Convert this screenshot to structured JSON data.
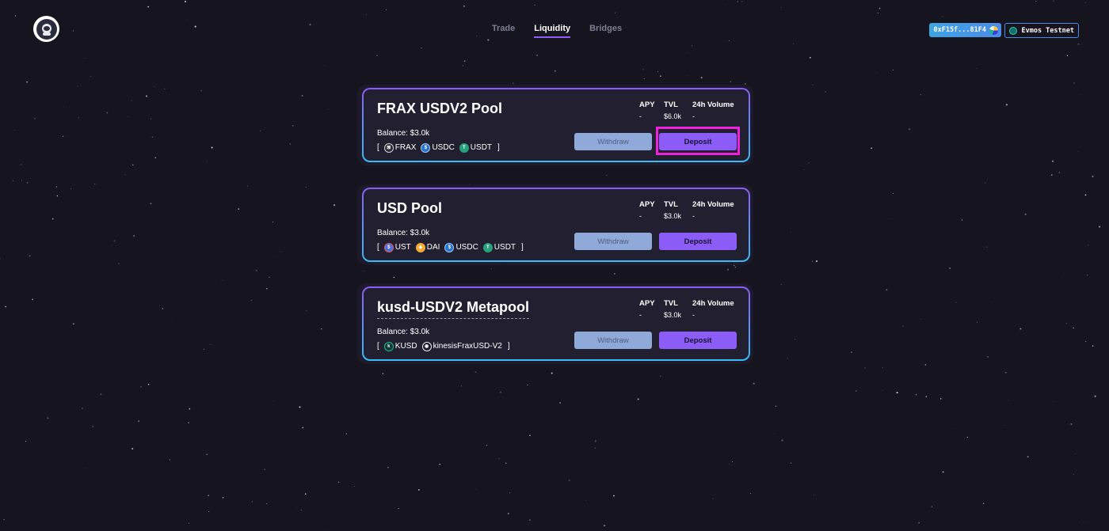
{
  "nav": {
    "items": [
      {
        "label": "Trade",
        "active": false
      },
      {
        "label": "Liquidity",
        "active": true
      },
      {
        "label": "Bridges",
        "active": false
      }
    ]
  },
  "wallet": {
    "address": "0xF15f...81F4"
  },
  "network": {
    "label": "Evmos Testnet"
  },
  "stat_labels": {
    "apy": "APY",
    "tvl": "TVL",
    "volume": "24h Volume"
  },
  "buttons": {
    "withdraw": "Withdraw",
    "deposit": "Deposit"
  },
  "pools": [
    {
      "title": "FRAX USDV2 Pool",
      "balance": "Balance: $3.0k",
      "open_bracket": "[",
      "close_bracket": "]",
      "tokens": [
        {
          "name": "FRAX",
          "icon": "frax-icon"
        },
        {
          "name": "USDC",
          "icon": "usdc-icon"
        },
        {
          "name": "USDT",
          "icon": "usdt-icon"
        }
      ],
      "apy": "-",
      "tvl": "$6.0k",
      "volume": "-",
      "deposit_highlighted": true
    },
    {
      "title": "USD Pool",
      "balance": "Balance: $3.0k",
      "open_bracket": "[",
      "close_bracket": "]",
      "tokens": [
        {
          "name": "UST",
          "icon": "ust-icon"
        },
        {
          "name": "DAI",
          "icon": "dai-icon"
        },
        {
          "name": "USDC",
          "icon": "usdc-icon"
        },
        {
          "name": "USDT",
          "icon": "usdt-icon"
        }
      ],
      "apy": "-",
      "tvl": "$3.0k",
      "volume": "-",
      "deposit_highlighted": false
    },
    {
      "title": "kusd-USDV2 Metapool",
      "balance": "Balance: $3.0k",
      "open_bracket": "[",
      "close_bracket": "]",
      "tokens": [
        {
          "name": "KUSD",
          "icon": "kusd-icon"
        },
        {
          "name": "kinesisFraxUSD-V2",
          "icon": "kinesis-icon"
        }
      ],
      "apy": "-",
      "tvl": "$3.0k",
      "volume": "-",
      "deposit_highlighted": false
    }
  ]
}
